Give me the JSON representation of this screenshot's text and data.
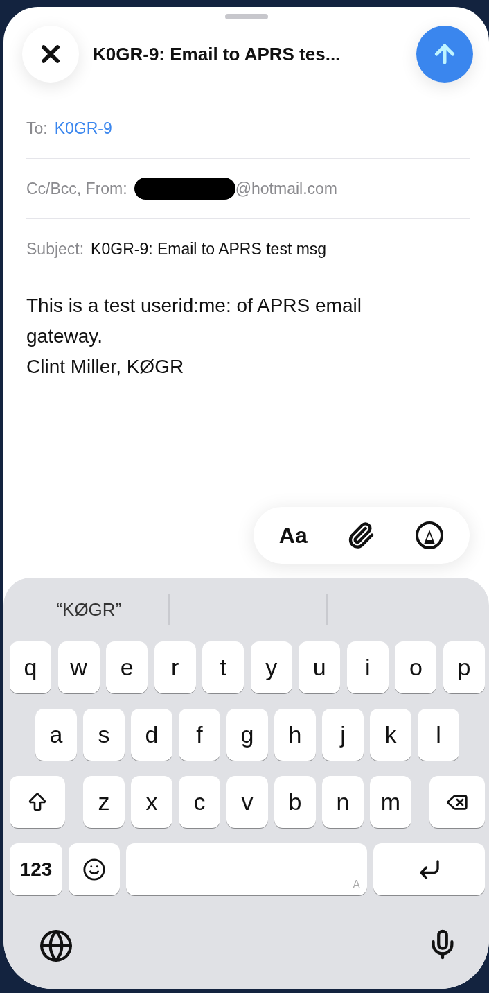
{
  "header": {
    "title": "K0GR-9: Email to APRS tes..."
  },
  "fields": [
    {
      "kind": "to",
      "label": "To:",
      "value": "K0GR-9"
    },
    {
      "kind": "from",
      "label": "Cc/Bcc, From:",
      "value": "@hotmail.com",
      "redacted": true
    },
    {
      "kind": "subject",
      "label": "Subject:",
      "value": "K0GR-9: Email to APRS test msg"
    }
  ],
  "body": [
    "This is a test userid:me: of APRS email gateway.",
    "Clint Miller, KØGR"
  ],
  "format_toolbar": {
    "text_button": "Aa"
  },
  "suggestions": [
    {
      "text": "“KØGR”"
    }
  ],
  "keyboard": {
    "rows": [
      [
        "q",
        "w",
        "e",
        "r",
        "t",
        "y",
        "u",
        "i",
        "o",
        "p"
      ],
      [
        "a",
        "s",
        "d",
        "f",
        "g",
        "h",
        "j",
        "k",
        "l"
      ],
      [
        "z",
        "x",
        "c",
        "v",
        "b",
        "n",
        "m"
      ]
    ],
    "shift_on": false,
    "numbers_key": "123",
    "space_hint": "A"
  }
}
